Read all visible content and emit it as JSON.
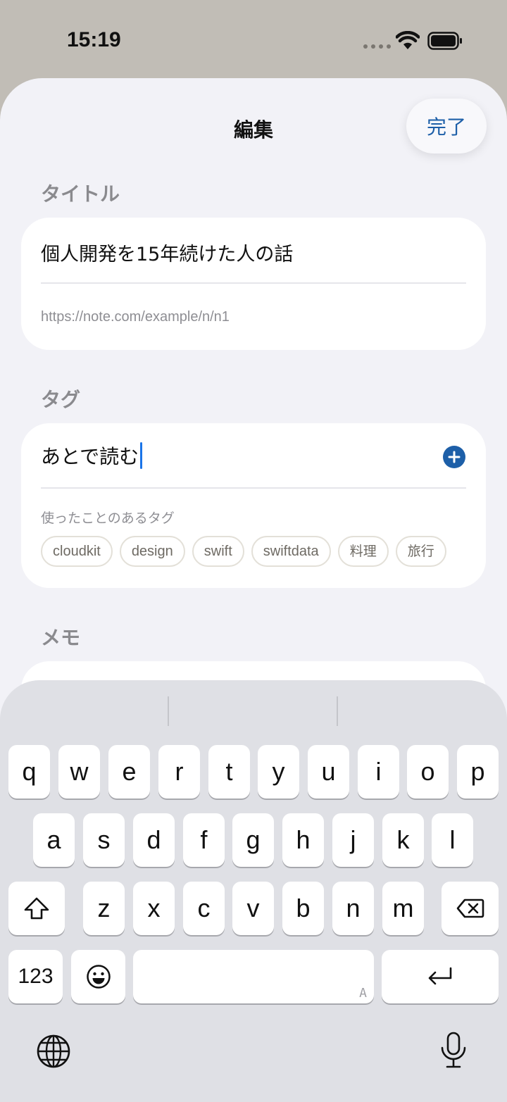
{
  "status_bar": {
    "time": "15:19",
    "icons": [
      "cellular-dots-icon",
      "wifi-icon",
      "battery-icon"
    ]
  },
  "nav": {
    "title": "編集",
    "done_label": "完了"
  },
  "title_section": {
    "label": "タイトル",
    "title_value": "個人開発を15年続けた人の話",
    "url_value": "https://note.com/example/n/n1"
  },
  "tag_section": {
    "label": "タグ",
    "input_value": "あとで読む",
    "used_label": "使ったことのあるタグ",
    "tags": [
      "cloudkit",
      "design",
      "swift",
      "swiftdata",
      "料理",
      "旅行"
    ]
  },
  "memo_section": {
    "label": "メモ"
  },
  "keyboard": {
    "row1": [
      "q",
      "w",
      "e",
      "r",
      "t",
      "y",
      "u",
      "i",
      "o",
      "p"
    ],
    "row2": [
      "a",
      "s",
      "d",
      "f",
      "g",
      "h",
      "j",
      "k",
      "l"
    ],
    "row3": [
      "z",
      "x",
      "c",
      "v",
      "b",
      "n",
      "m"
    ],
    "numbers_label": "123",
    "space_hint": "A",
    "colors": {
      "accent": "#1d5fa8",
      "caret": "#1a74e8",
      "keyboard_bg": "#dfe0e5"
    }
  }
}
